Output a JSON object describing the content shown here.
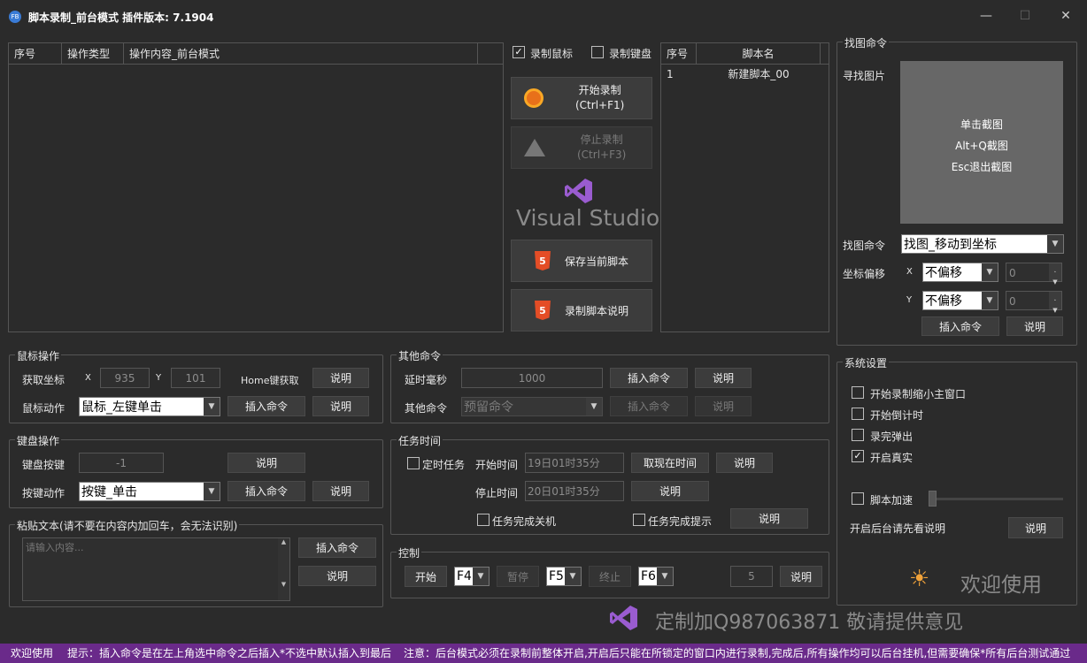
{
  "window": {
    "title": "脚本录制_前台模式  插件版本: 7.1904",
    "app_icon": "FB",
    "minimize": "—",
    "maximize": "☐",
    "close": "✕"
  },
  "op_table": {
    "columns": [
      "序号",
      "操作类型",
      "操作内容_前台模式"
    ]
  },
  "record": {
    "mouse_label": "录制鼠标",
    "mouse_checked": true,
    "keyboard_label": "录制键盘",
    "keyboard_checked": false,
    "start_line1": "开始录制",
    "start_line2": "(Ctrl+F1)",
    "stop_line1": "停止录制",
    "stop_line2": "(Ctrl+F3)",
    "logo_text": "Visual Studio",
    "save": "保存当前脚本",
    "desc": "录制脚本说明",
    "html_badge": "5"
  },
  "script_table": {
    "columns": [
      "序号",
      "脚本名"
    ],
    "rows": [
      {
        "no": "1",
        "name": "新建脚本_00"
      }
    ]
  },
  "find": {
    "legend": "找图命令",
    "find_img": "寻找图片",
    "click_shot": "单击截图",
    "alt_q": "Alt+Q截图",
    "esc": "Esc退出截图",
    "cmd_label": "找图命令",
    "cmd_value": "找图_移动到坐标",
    "offset_label": "坐标偏移",
    "x_label": "X",
    "y_label": "Y",
    "x_mode": "不偏移",
    "y_mode": "不偏移",
    "x_value": "0",
    "y_value": "0",
    "insert": "插入命令",
    "explain": "说明"
  },
  "mouse": {
    "legend": "鼠标操作",
    "get_coord": "获取坐标",
    "x_label": "X",
    "x": "935",
    "y_label": "Y",
    "y": "101",
    "home": "Home键获取",
    "explain": "说明",
    "action_label": "鼠标动作",
    "action": "鼠标_左键单击",
    "insert": "插入命令"
  },
  "other": {
    "legend": "其他命令",
    "delay_label": "延时毫秒",
    "delay": "1000",
    "insert": "插入命令",
    "explain": "说明",
    "other_label": "其他命令",
    "other_value": "预留命令"
  },
  "keyboard": {
    "legend": "键盘操作",
    "key_label": "键盘按键",
    "key_value": "-1",
    "explain": "说明",
    "action_label": "按键动作",
    "action": "按键_单击",
    "insert": "插入命令"
  },
  "task": {
    "legend": "任务时间",
    "timed": "定时任务",
    "start_label": "开始时间",
    "start_value": "19日01时35分",
    "now": "取现在时间",
    "explain": "说明",
    "stop_label": "停止时间",
    "stop_value": "20日01时35分",
    "shutdown": "任务完成关机",
    "notify": "任务完成提示"
  },
  "paste": {
    "legend": "粘贴文本(请不要在内容内加回车，会无法识别)",
    "placeholder": "请输入内容...",
    "insert": "插入命令",
    "explain": "说明"
  },
  "control": {
    "legend": "控制",
    "start": "开始",
    "f4": "F4",
    "pause": "暂停",
    "f5": "F5",
    "end": "终止",
    "f6": "F6",
    "count": "5",
    "explain": "说明"
  },
  "system": {
    "legend": "系统设置",
    "opt1": "开始录制缩小主窗口",
    "opt2": "开始倒计时",
    "opt3": "录完弹出",
    "opt4": "开启真实",
    "opt4_checked": true,
    "speed": "脚本加速",
    "bg_note": "开启后台请先看说明",
    "explain": "说明",
    "welcome": "欢迎使用",
    "sun": "☀"
  },
  "watermark": "定制加Q987063871  敬请提供意见",
  "status": {
    "s1": "欢迎使用",
    "s2": "提示：插入命令是在左上角选中命令之后插入*不选中默认插入到最后",
    "s3": "注意：后台模式必须在录制前整体开启,开启后只能在所锁定的窗口内进行录制,完成后,所有操作均可以后台挂机,但需要确保*所有后台测试通过"
  }
}
